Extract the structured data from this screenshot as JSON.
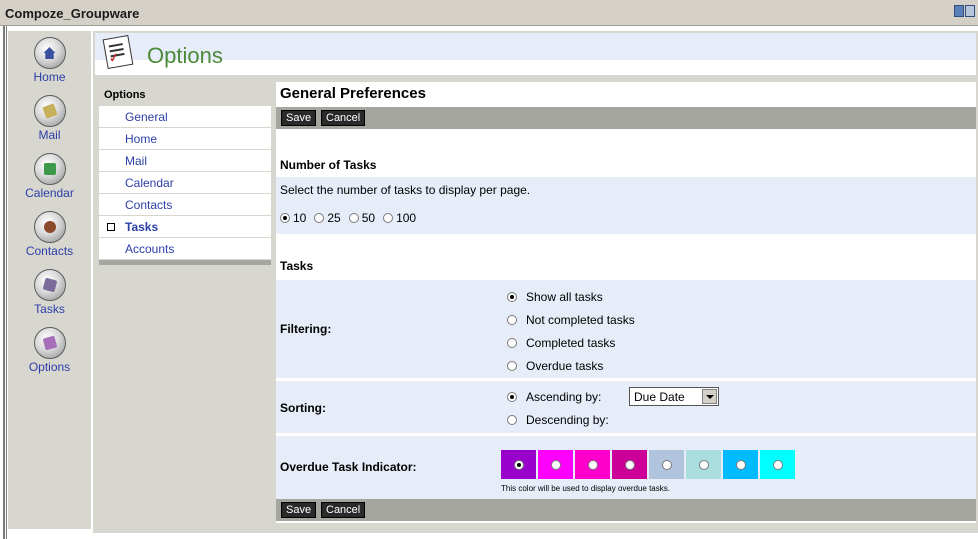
{
  "app": {
    "title": "Compoze_Groupware"
  },
  "leftnav": [
    {
      "label": "Home",
      "icon": "home-icon"
    },
    {
      "label": "Mail",
      "icon": "mail-icon"
    },
    {
      "label": "Calendar",
      "icon": "calendar-icon"
    },
    {
      "label": "Contacts",
      "icon": "contacts-icon"
    },
    {
      "label": "Tasks",
      "icon": "tasks-icon"
    },
    {
      "label": "Options",
      "icon": "options-icon"
    }
  ],
  "header": {
    "title": "Options",
    "icon": "options-icon"
  },
  "submenu": {
    "title": "Options",
    "items": [
      "General",
      "Home",
      "Mail",
      "Calendar",
      "Contacts",
      "Tasks",
      "Accounts"
    ],
    "active": "Tasks"
  },
  "content": {
    "title": "General Preferences",
    "save_label": "Save",
    "cancel_label": "Cancel",
    "num_tasks": {
      "heading": "Number of Tasks",
      "description": "Select the number of tasks to display per page.",
      "options": [
        "10",
        "25",
        "50",
        "100"
      ],
      "selected": "10"
    },
    "tasks": {
      "heading": "Tasks",
      "filtering": {
        "label": "Filtering:",
        "options": [
          "Show all tasks",
          "Not completed tasks",
          "Completed tasks",
          "Overdue tasks"
        ],
        "selected": "Show all tasks"
      },
      "sorting": {
        "label": "Sorting:",
        "ascending_label": "Ascending by:",
        "descending_label": "Descending by:",
        "selected": "Ascending by:",
        "sort_field": "Due Date"
      },
      "overdue": {
        "label": "Overdue Task Indicator:",
        "colors": [
          "#9900cc",
          "#ff00ff",
          "#ff00cc",
          "#cc0099",
          "#b0c4de",
          "#aadddd",
          "#00bbff",
          "#00ffff"
        ],
        "selected_index": 0,
        "note": "This color will be used to display overdue tasks."
      }
    }
  }
}
